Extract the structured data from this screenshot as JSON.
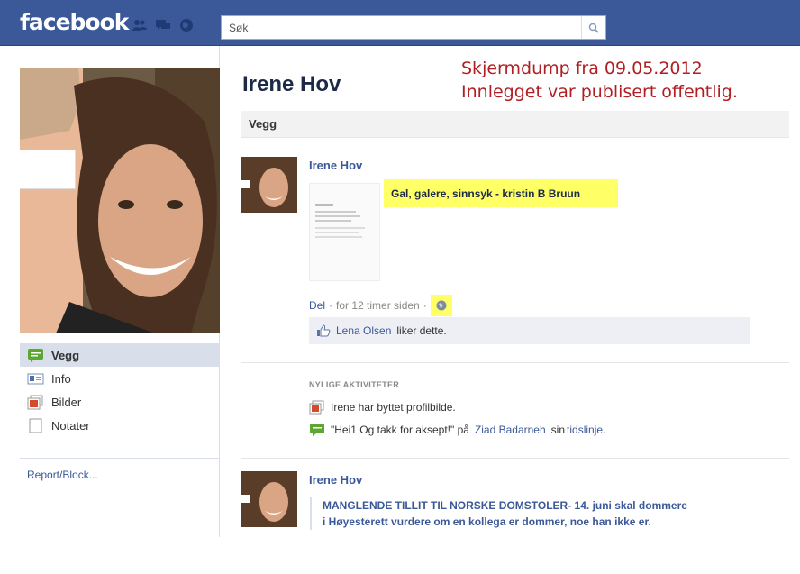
{
  "header": {
    "logo": "facebook",
    "search_placeholder": "Søk"
  },
  "profile": {
    "name": "Irene Hov"
  },
  "sidebar": {
    "items": [
      {
        "label": "Vegg",
        "icon": "wall-icon",
        "active": true
      },
      {
        "label": "Info",
        "icon": "info-icon",
        "active": false
      },
      {
        "label": "Bilder",
        "icon": "photos-icon",
        "active": false
      },
      {
        "label": "Notater",
        "icon": "notes-icon",
        "active": false
      }
    ],
    "report_link": "Report/Block..."
  },
  "overlay_note": {
    "line1": "Skjermdump fra 09.05.2012",
    "line2": "Innlegget var publisert offentlig."
  },
  "wall": {
    "tab_label": "Vegg",
    "post1": {
      "author": "Irene Hov",
      "attachment_title": "Gal, galere, sinnsyk - kristin B Bruun",
      "share_label": "Del",
      "separator": "·",
      "time": "for 12 timer siden",
      "likes_name": "Lena Olsen",
      "likes_suffix": "liker dette."
    },
    "recent": {
      "heading": "NYLIGE AKTIVITETER",
      "item1": "Irene har byttet profilbilde.",
      "item2_prefix": "\"Hei1 Og takk for aksept!\" på",
      "item2_name": "Ziad Badarneh",
      "item2_mid": "sin",
      "item2_link": "tidslinje",
      "item2_end": "."
    },
    "post2": {
      "author": "Irene Hov",
      "text_line1": "MANGLENDE TILLIT TIL NORSKE DOMSTOLER- 14. juni skal dommere",
      "text_line2": "i Høyesterett vurdere om en kollega er dommer, noe han ikke er."
    }
  },
  "colors": {
    "brand_blue": "#3b5998",
    "highlight_yellow": "#ffff66",
    "note_red": "#b01f24"
  }
}
